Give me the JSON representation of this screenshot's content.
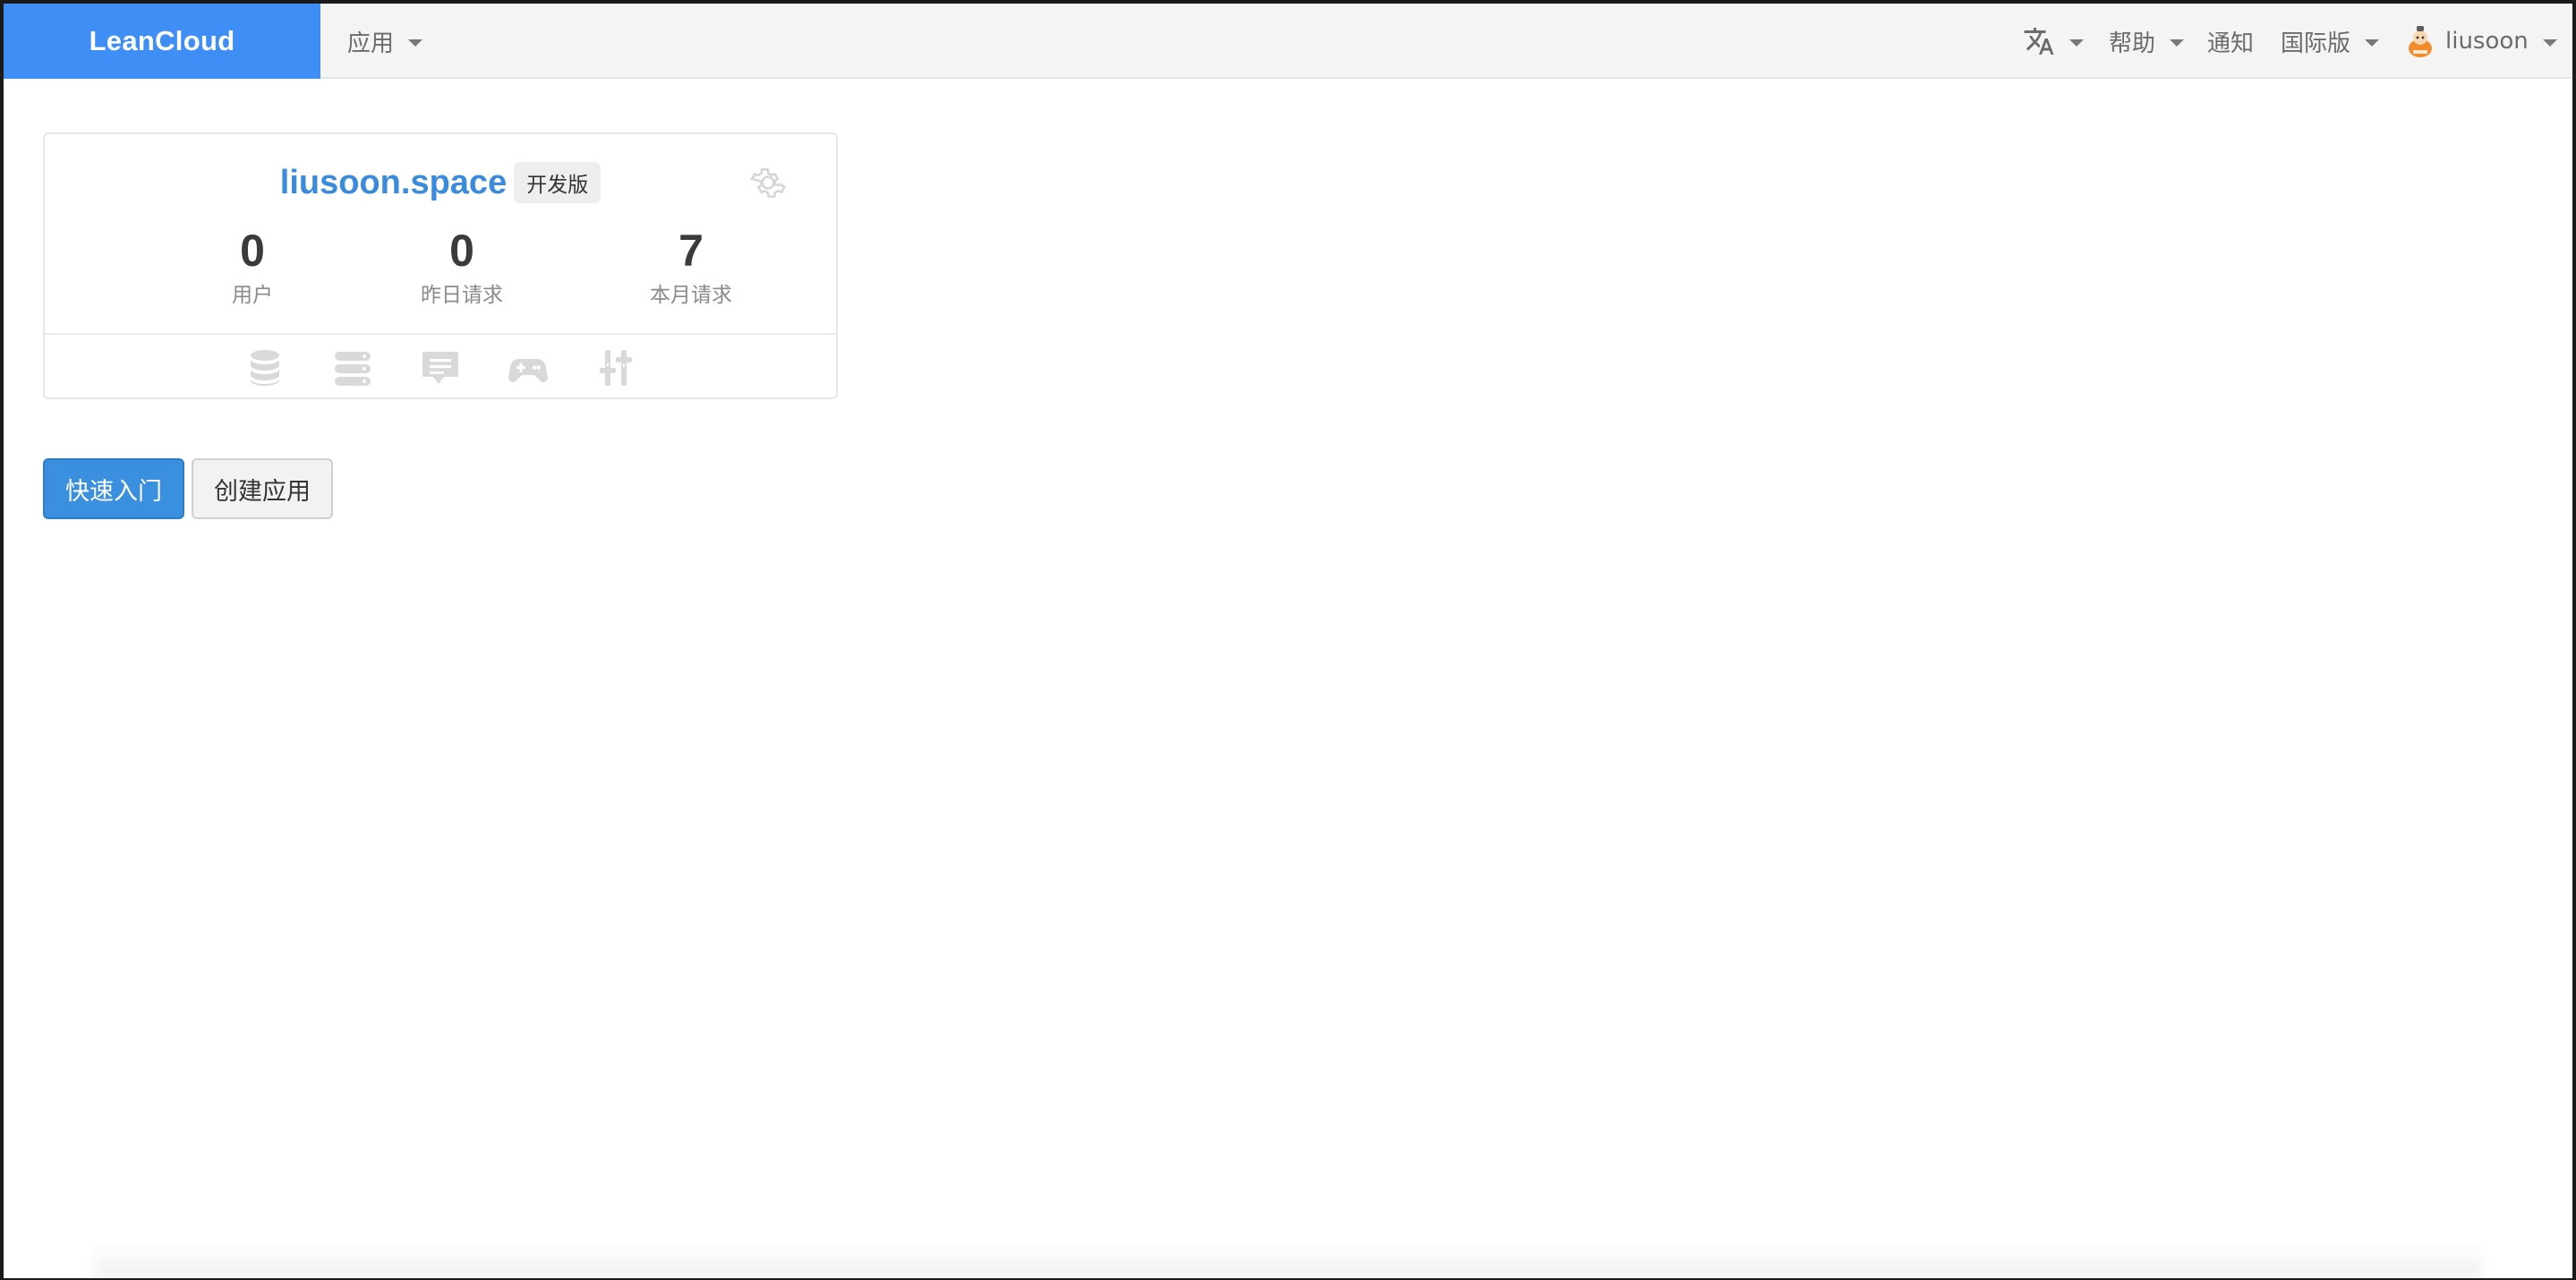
{
  "navbar": {
    "brand": "LeanCloud",
    "apps_menu": "应用",
    "language_icon": "translate-icon",
    "help_menu": "帮助",
    "notifications": "通知",
    "region_menu": "国际版",
    "user_name": "liusoon"
  },
  "app_card": {
    "name": "liusoon.space",
    "plan": "开发版",
    "stats": [
      {
        "value": "0",
        "label": "用户"
      },
      {
        "value": "0",
        "label": "昨日请求"
      },
      {
        "value": "7",
        "label": "本月请求"
      }
    ],
    "service_icons": [
      "database-icon",
      "server-stack-icon",
      "message-icon",
      "gamepad-icon",
      "sliders-icon"
    ]
  },
  "actions": {
    "quick_start": "快速入门",
    "create_app": "创建应用"
  },
  "colors": {
    "brand": "#3e8ef5",
    "app_link": "#3a8bdc",
    "primary_button": "#3a8fdf"
  }
}
